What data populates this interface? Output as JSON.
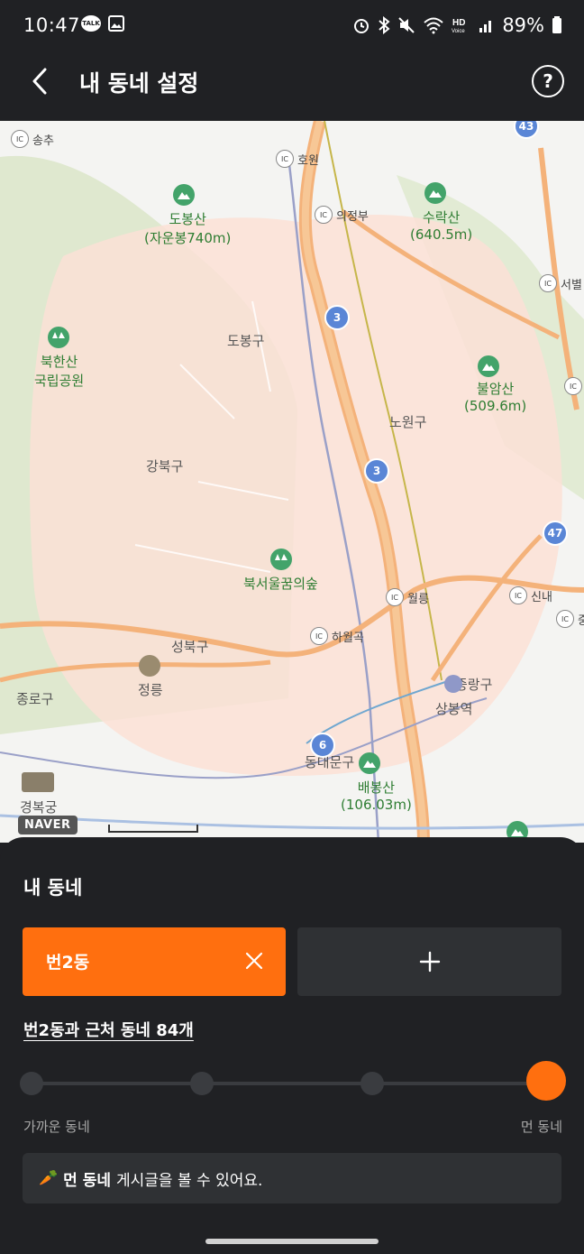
{
  "status": {
    "time": "10:47",
    "talk": "TALK",
    "battery": "89%"
  },
  "header": {
    "title": "내 동네 설정",
    "help": "?"
  },
  "map": {
    "labels": {
      "songchu": "송추",
      "howon": "호원",
      "uijeongbu": "의정부",
      "seobyeol": "서별",
      "dobongsan": "도봉산",
      "dobongsan_sub": "(자운봉740m)",
      "suraksan": "수락산",
      "suraksan_sub": "(640.5m)",
      "dobonggu": "도봉구",
      "bukhansan": "북한산",
      "bukhansan_sub": "국립공원",
      "buramsan": "불암산",
      "buramsan_sub": "(509.6m)",
      "nowongu": "노원구",
      "gangbukgu": "강북구",
      "forest": "북서울꿈의숲",
      "wolleung": "월릉",
      "sinnae": "신내",
      "jung": "중",
      "hawolgok": "하월곡",
      "seongbukgu": "성북구",
      "jeongneung": "정릉",
      "jongnogu": "종로구",
      "junggu": "중랑구",
      "sangbongyeok": "상봉역",
      "dongdaemungu": "동대문구",
      "baebongsan": "배봉산",
      "baebongsan_sub": "(106.03m)",
      "gyeongbokgung": "경복궁"
    },
    "routes": {
      "r3": "3",
      "r43": "43",
      "r47": "47",
      "r6": "6"
    },
    "ic": "IC",
    "logo": "NAVER"
  },
  "sheet": {
    "title": "내 동네",
    "selected_neighborhood": "번2동",
    "range_text": "번2동과 근처 동네 84개",
    "slider": {
      "min_label": "가까운 동네",
      "max_label": "먼 동네",
      "steps": 4,
      "selected_step": 4
    },
    "info": {
      "emoji": "🥕",
      "bold": "먼 동네",
      "text": "게시글을 볼 수 있어요."
    }
  }
}
